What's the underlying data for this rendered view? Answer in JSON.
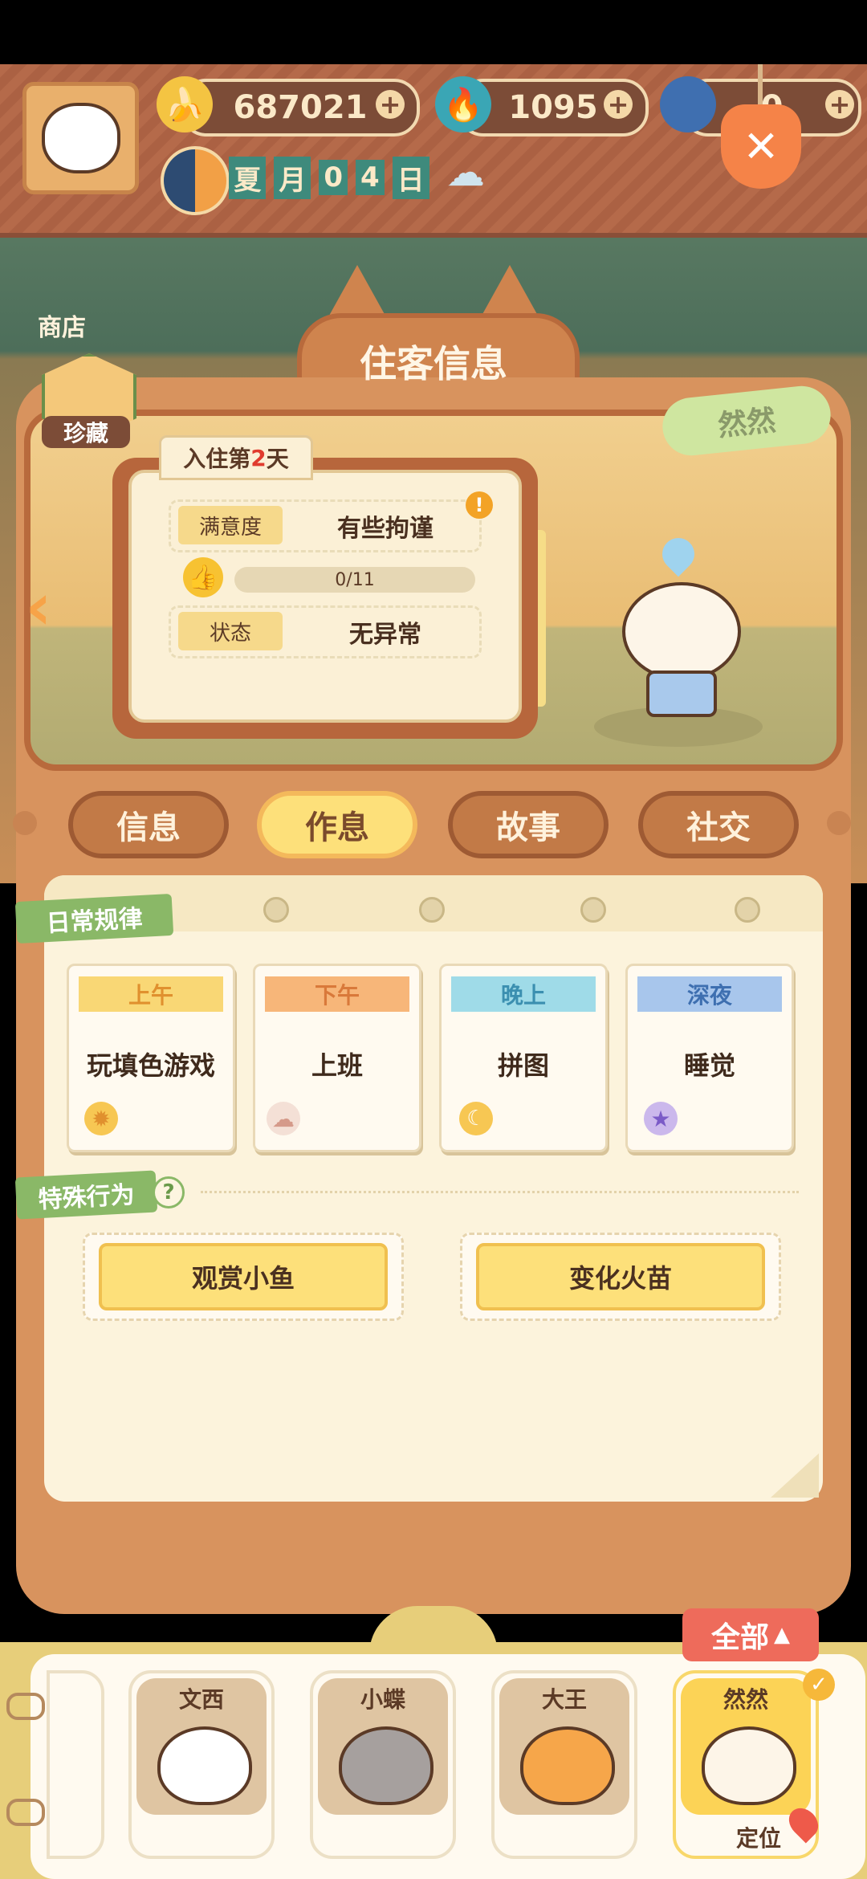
{
  "top_bar": {
    "bananas": "687021",
    "flames": "1095",
    "third_resource": "0",
    "season_day": [
      "夏",
      "月",
      "0",
      "4",
      "日"
    ]
  },
  "side_left": {
    "shop_label": "商店",
    "collection_label": "珍藏"
  },
  "resident_info": {
    "title": "住客信息",
    "name_tag": "然然",
    "stay_prefix": "入住第",
    "stay_days": "2",
    "stay_suffix": "天",
    "satisfaction_label": "满意度",
    "satisfaction_value": "有些拘谨",
    "progress_text": "0/11",
    "status_label": "状态",
    "status_value": "无异常"
  },
  "tabs": [
    {
      "label": "信息",
      "active": false
    },
    {
      "label": "作息",
      "active": true
    },
    {
      "label": "故事",
      "active": false
    },
    {
      "label": "社交",
      "active": false
    }
  ],
  "schedule": {
    "section_title": "日常规律",
    "slots": [
      {
        "time": "上午",
        "activity": "玩填色游戏",
        "icon": "sun-icon",
        "head_color": "#f9d775",
        "text_color": "#e0902e"
      },
      {
        "time": "下午",
        "activity": "上班",
        "icon": "cloud-icon",
        "head_color": "#f7b679",
        "text_color": "#d9793a"
      },
      {
        "time": "晚上",
        "activity": "拼图",
        "icon": "moon-icon",
        "head_color": "#9fdbe8",
        "text_color": "#3b8fb0"
      },
      {
        "time": "深夜",
        "activity": "睡觉",
        "icon": "star-icon",
        "head_color": "#a8c6ec",
        "text_color": "#3e6fb0"
      }
    ]
  },
  "special": {
    "section_title": "特殊行为",
    "help": "?",
    "behaviors": [
      "观赏小鱼",
      "变化火苗"
    ]
  },
  "roster": {
    "all_button": "全部",
    "locate_label": "定位",
    "members": [
      {
        "name": "文西"
      },
      {
        "name": "小蝶"
      },
      {
        "name": "大王"
      },
      {
        "name": "然然",
        "selected": true
      }
    ]
  },
  "colors": {
    "accent_yellow": "#fde07a",
    "card_brown": "#d8935e",
    "ribbon_green": "#8ab867",
    "all_red": "#ee6b5b"
  }
}
